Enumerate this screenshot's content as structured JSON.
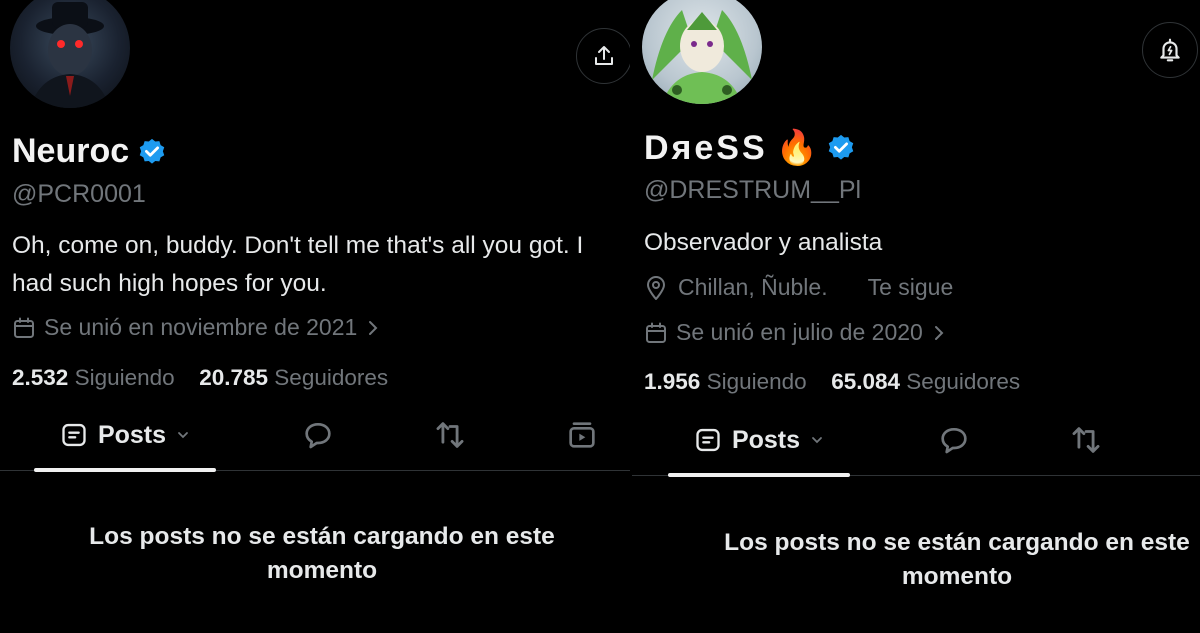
{
  "profiles": [
    {
      "name": "Neuroc",
      "handle": "@PCR0001",
      "bio": "Oh, come on, buddy. Don't tell me that's all you got. I had such high hopes for you.",
      "joined": "Se unió en noviembre de 2021",
      "following_count": "2.532",
      "following_label": "Siguiendo",
      "followers_count": "20.785",
      "followers_label": "Seguidores",
      "tab_posts": "Posts",
      "empty_message": "Los posts no se están cargando en este momento",
      "top_icon": "share-icon"
    },
    {
      "name": "DяeSS",
      "name_emoji": "🔥",
      "handle": "@DRESTRUM__Pl",
      "bio": "Observador y analista",
      "location": "Chillan, Ñuble.",
      "follows_you": "Te sigue",
      "joined": "Se unió en julio de 2020",
      "following_count": "1.956",
      "following_label": "Siguiendo",
      "followers_count": "65.084",
      "followers_label": "Seguidores",
      "tab_posts": "Posts",
      "empty_message": "Los posts no se están cargando en este momento",
      "top_icon": "bell-icon"
    }
  ],
  "colors": {
    "background": "#000000",
    "verified": "#1d9bf0",
    "muted": "#71767b",
    "text": "#e7e9ea"
  }
}
